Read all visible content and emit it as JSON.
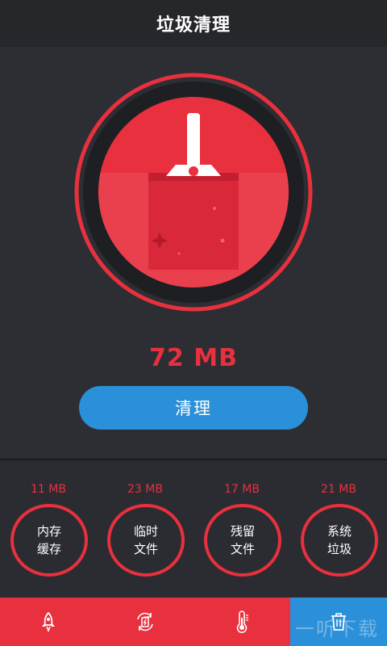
{
  "header": {
    "title": "垃圾清理"
  },
  "summary": {
    "junk_size": "72 MB"
  },
  "actions": {
    "clean_label": "清理"
  },
  "categories": [
    {
      "size": "11 MB",
      "line1": "内存",
      "line2": "缓存"
    },
    {
      "size": "23 MB",
      "line1": "临时",
      "line2": "文件"
    },
    {
      "size": "17 MB",
      "line1": "残留",
      "line2": "文件"
    },
    {
      "size": "21 MB",
      "line1": "系统",
      "line2": "垃圾"
    }
  ],
  "tabs": [
    {
      "icon": "rocket-icon",
      "active": false
    },
    {
      "icon": "battery-recycle-icon",
      "active": false
    },
    {
      "icon": "thermometer-icon",
      "active": false
    },
    {
      "icon": "trash-icon",
      "active": true
    }
  ],
  "colors": {
    "accent_red": "#e8303e",
    "accent_blue": "#2a90d9",
    "background": "#2b2c31"
  },
  "watermark": "一听下载"
}
